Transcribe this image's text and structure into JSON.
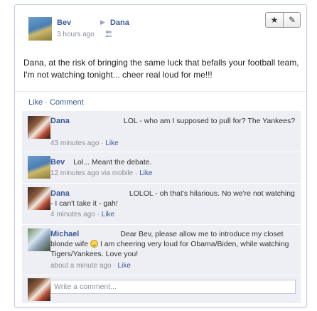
{
  "post": {
    "author": "Bev",
    "target": "Dana",
    "arrow_icon": "triangle-right-icon",
    "time": "3 hours ago",
    "audience_icon": "friends-icon",
    "text": "Dana, at the risk of bringing the same luck that befalls your football team, I'm not watching tonight... cheer real loud for me!!!",
    "actions": {
      "like": "Like",
      "sep": "·",
      "comment": "Comment"
    },
    "tools": {
      "star_icon": "star-icon",
      "edit_icon": "pencil-icon"
    }
  },
  "comments": [
    {
      "author": "Dana",
      "text": "LOL - who am I supposed to pull for? The Yankees?",
      "time": "43 minutes ago",
      "via": "",
      "like": "Like"
    },
    {
      "author": "Bev",
      "text": "Lol... Meant the debate.",
      "time": "12 minutes ago",
      "via": "via mobile",
      "like": "Like"
    },
    {
      "author": "Dana",
      "text": "LOLOL - oh that's hilarious. No we're not watching - I can't take it - gah!",
      "time": "4 minutes ago",
      "via": "",
      "like": "Like"
    },
    {
      "author": "Michael",
      "text_a": "Dear Bev, please allow me to introduce my closet blonde wife",
      "text_b": "I am cheering very loud for Obama/Biden, while watching Tigers/Yankees. Love you!",
      "emoji": "smiley-icon",
      "time": "about a minute ago",
      "via": "",
      "like": "Like"
    }
  ],
  "composer": {
    "placeholder": "Write a comment..."
  }
}
